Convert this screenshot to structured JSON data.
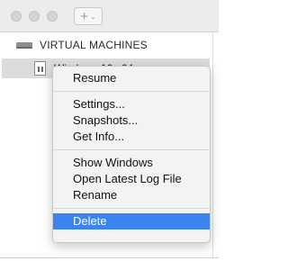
{
  "toolbar": {
    "add_symbol": "+",
    "chevron_symbol": "⌄"
  },
  "sidebar": {
    "section_title": "VIRTUAL MACHINES",
    "vm_item_name": "Windows 10 x64"
  },
  "context_menu": {
    "items": [
      {
        "label": "Resume"
      },
      {
        "label": "Settings..."
      },
      {
        "label": "Snapshots..."
      },
      {
        "label": "Get Info..."
      },
      {
        "label": "Show Windows"
      },
      {
        "label": "Open Latest Log File"
      },
      {
        "label": "Rename"
      },
      {
        "label": "Delete",
        "highlighted": true
      }
    ]
  },
  "colors": {
    "highlight": "#3b84f0",
    "menu_background": "#f3f3f3",
    "selected_row": "#dcdcdc"
  },
  "icons": {
    "window_controls": [
      "close-light-icon",
      "minimize-light-icon",
      "zoom-light-icon"
    ],
    "section": "drive-icon",
    "vm": "vm-document-icon"
  }
}
